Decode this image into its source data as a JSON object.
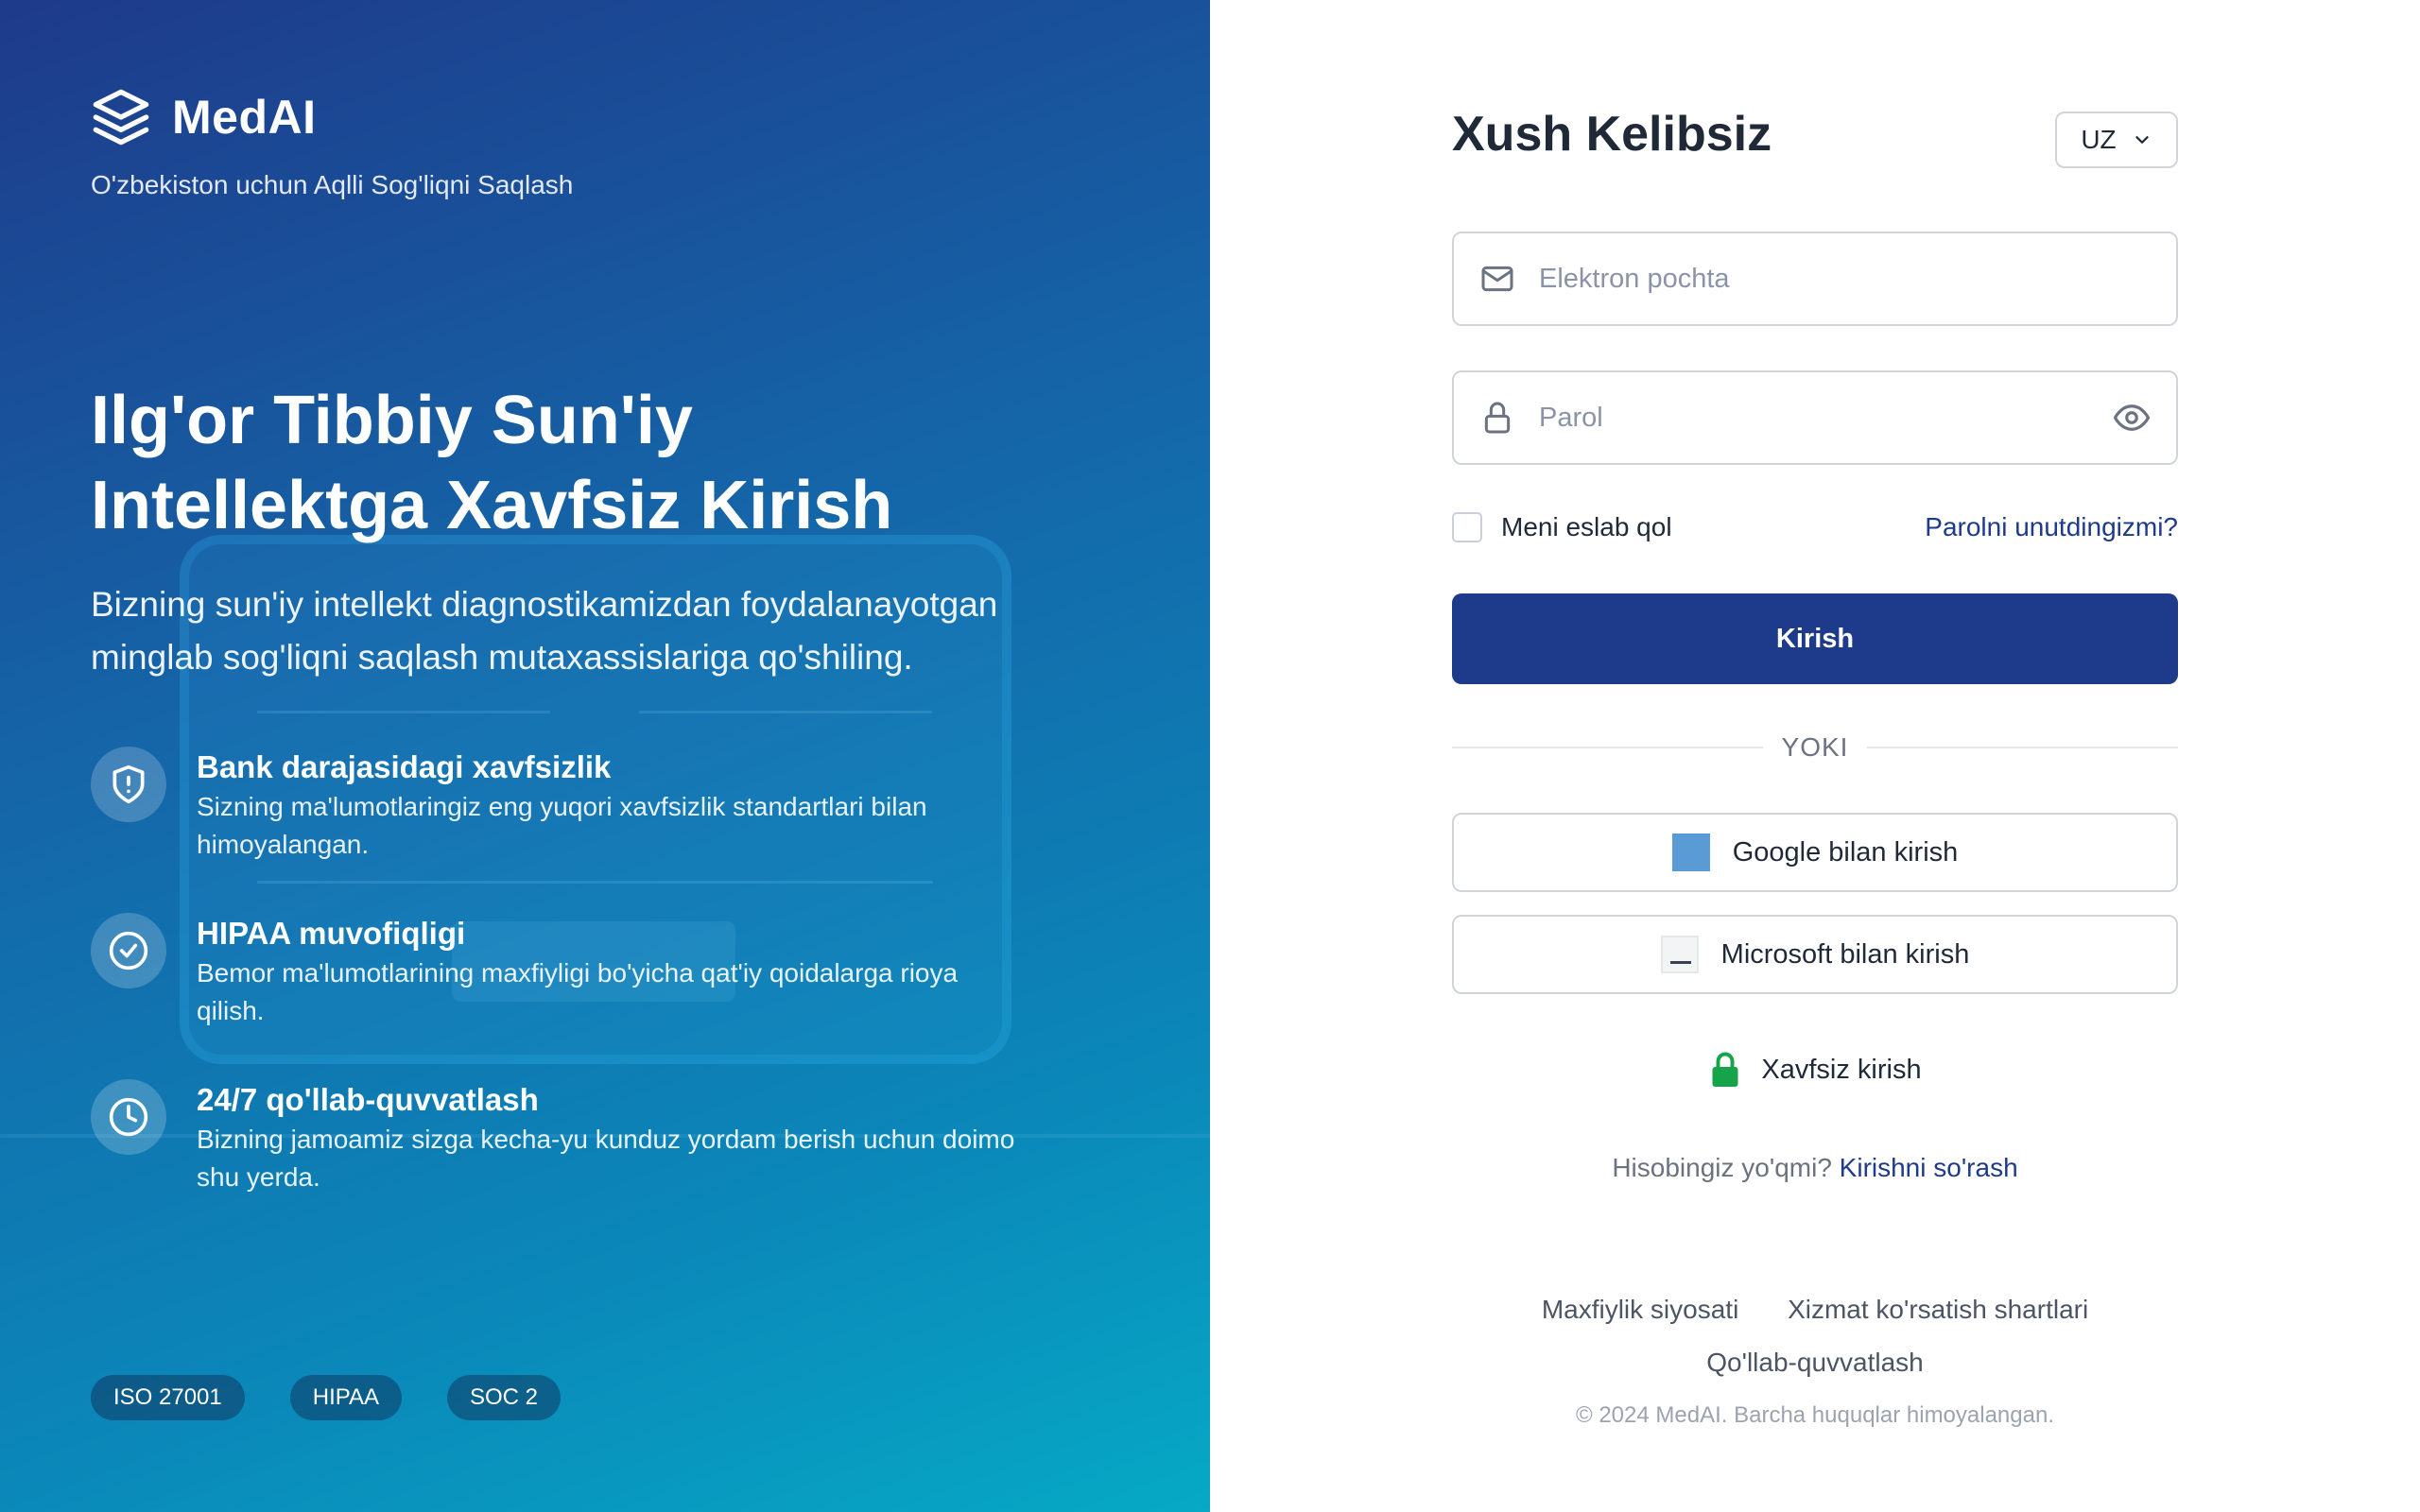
{
  "brand": {
    "name": "MedAI",
    "tagline": "O'zbekiston uchun Aqlli Sog'liqni Saqlash"
  },
  "hero": {
    "headline_line1": "Ilg'or Tibbiy Sun'iy",
    "headline_line2": "Intellektga Xavfsiz Kirish",
    "subhead": "Bizning sun'iy intellekt diagnostikamizdan foydalanayotgan minglab sog'liqni saqlash mutaxassislariga qo'shiling."
  },
  "features": [
    {
      "icon": "shield-icon",
      "title": "Bank darajasidagi xavfsizlik",
      "desc": "Sizning ma'lumotlaringiz eng yuqori xavfsizlik standartlari bilan himoyalangan."
    },
    {
      "icon": "check-circle-icon",
      "title": "HIPAA muvofiqligi",
      "desc": "Bemor ma'lumotlarining maxfiyligi bo'yicha qat'iy qoidalarga rioya qilish."
    },
    {
      "icon": "clock-icon",
      "title": "24/7 qo'llab-quvvatlash",
      "desc": "Bizning jamoamiz sizga kecha-yu kunduz yordam berish uchun doimo shu yerda."
    }
  ],
  "badges": [
    "ISO 27001",
    "HIPAA",
    "SOC 2"
  ],
  "login": {
    "title": "Xush Kelibsiz",
    "language": "UZ",
    "email_placeholder": "Elektron pochta",
    "email_value": "",
    "password_placeholder": "Parol",
    "password_value": "",
    "remember_label": "Meni eslab qol",
    "forgot_label": "Parolni unutdingizmi?",
    "submit_label": "Kirish",
    "divider_label": "YOKI",
    "google_label": "Google bilan kirish",
    "microsoft_label": "Microsoft bilan kirish",
    "secure_label": "Xavfsiz kirish",
    "no_account_text": "Hisobingiz yo'qmi?",
    "request_access_label": "Kirishni so'rash"
  },
  "footer": {
    "privacy": "Maxfiylik siyosati",
    "terms": "Xizmat ko'rsatish shartlari",
    "support": "Qo'llab-quvvatlash",
    "copyright": "© 2024 MedAI. Barcha huquqlar himoyalangan."
  },
  "colors": {
    "primary": "#1e3a8a",
    "gradient_start": "#1e3a8a",
    "gradient_end": "#06a9c6",
    "lock_green": "#16a34a"
  }
}
